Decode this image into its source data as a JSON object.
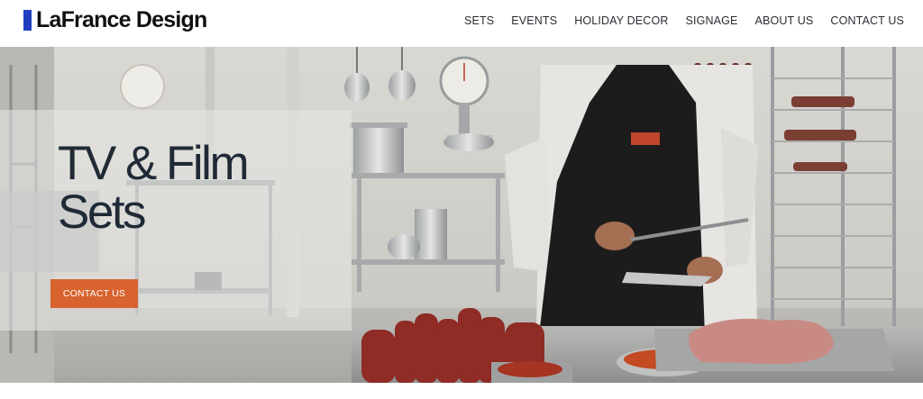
{
  "brand": {
    "name": "LaFrance Design",
    "accent": "#1d3fbf"
  },
  "nav": {
    "items": [
      "SETS",
      "EVENTS",
      "HOLIDAY DECOR",
      "SIGNAGE",
      "ABOUT US",
      "CONTACT US"
    ]
  },
  "hero": {
    "title_line1": "TV & Film",
    "title_line2": "Sets",
    "cta_label": "CONTACT US",
    "cta_color": "#d8632f",
    "image_subject": "chef-in-commercial-kitchen-photo"
  }
}
